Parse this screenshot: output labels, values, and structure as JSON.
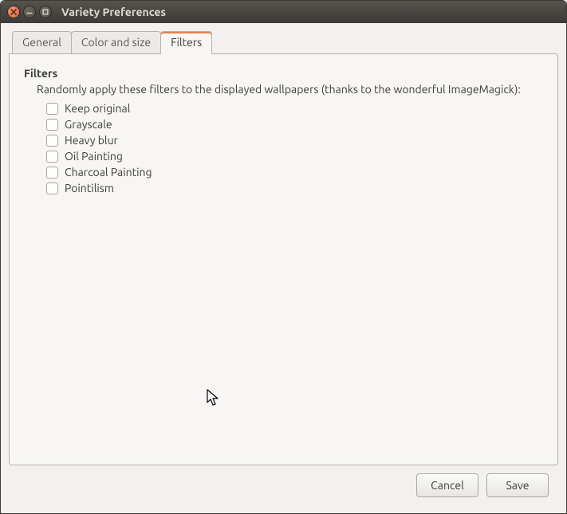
{
  "window": {
    "title": "Variety Preferences"
  },
  "tabs": {
    "general": "General",
    "color": "Color and size",
    "filters": "Filters"
  },
  "filters": {
    "heading": "Filters",
    "description": "Randomly apply these filters to the displayed wallpapers (thanks to the wonderful ImageMagick):",
    "items": [
      {
        "label": "Keep original"
      },
      {
        "label": "Grayscale"
      },
      {
        "label": "Heavy blur"
      },
      {
        "label": "Oil Painting"
      },
      {
        "label": "Charcoal Painting"
      },
      {
        "label": "Pointilism"
      }
    ]
  },
  "buttons": {
    "cancel": "Cancel",
    "save": "Save"
  }
}
